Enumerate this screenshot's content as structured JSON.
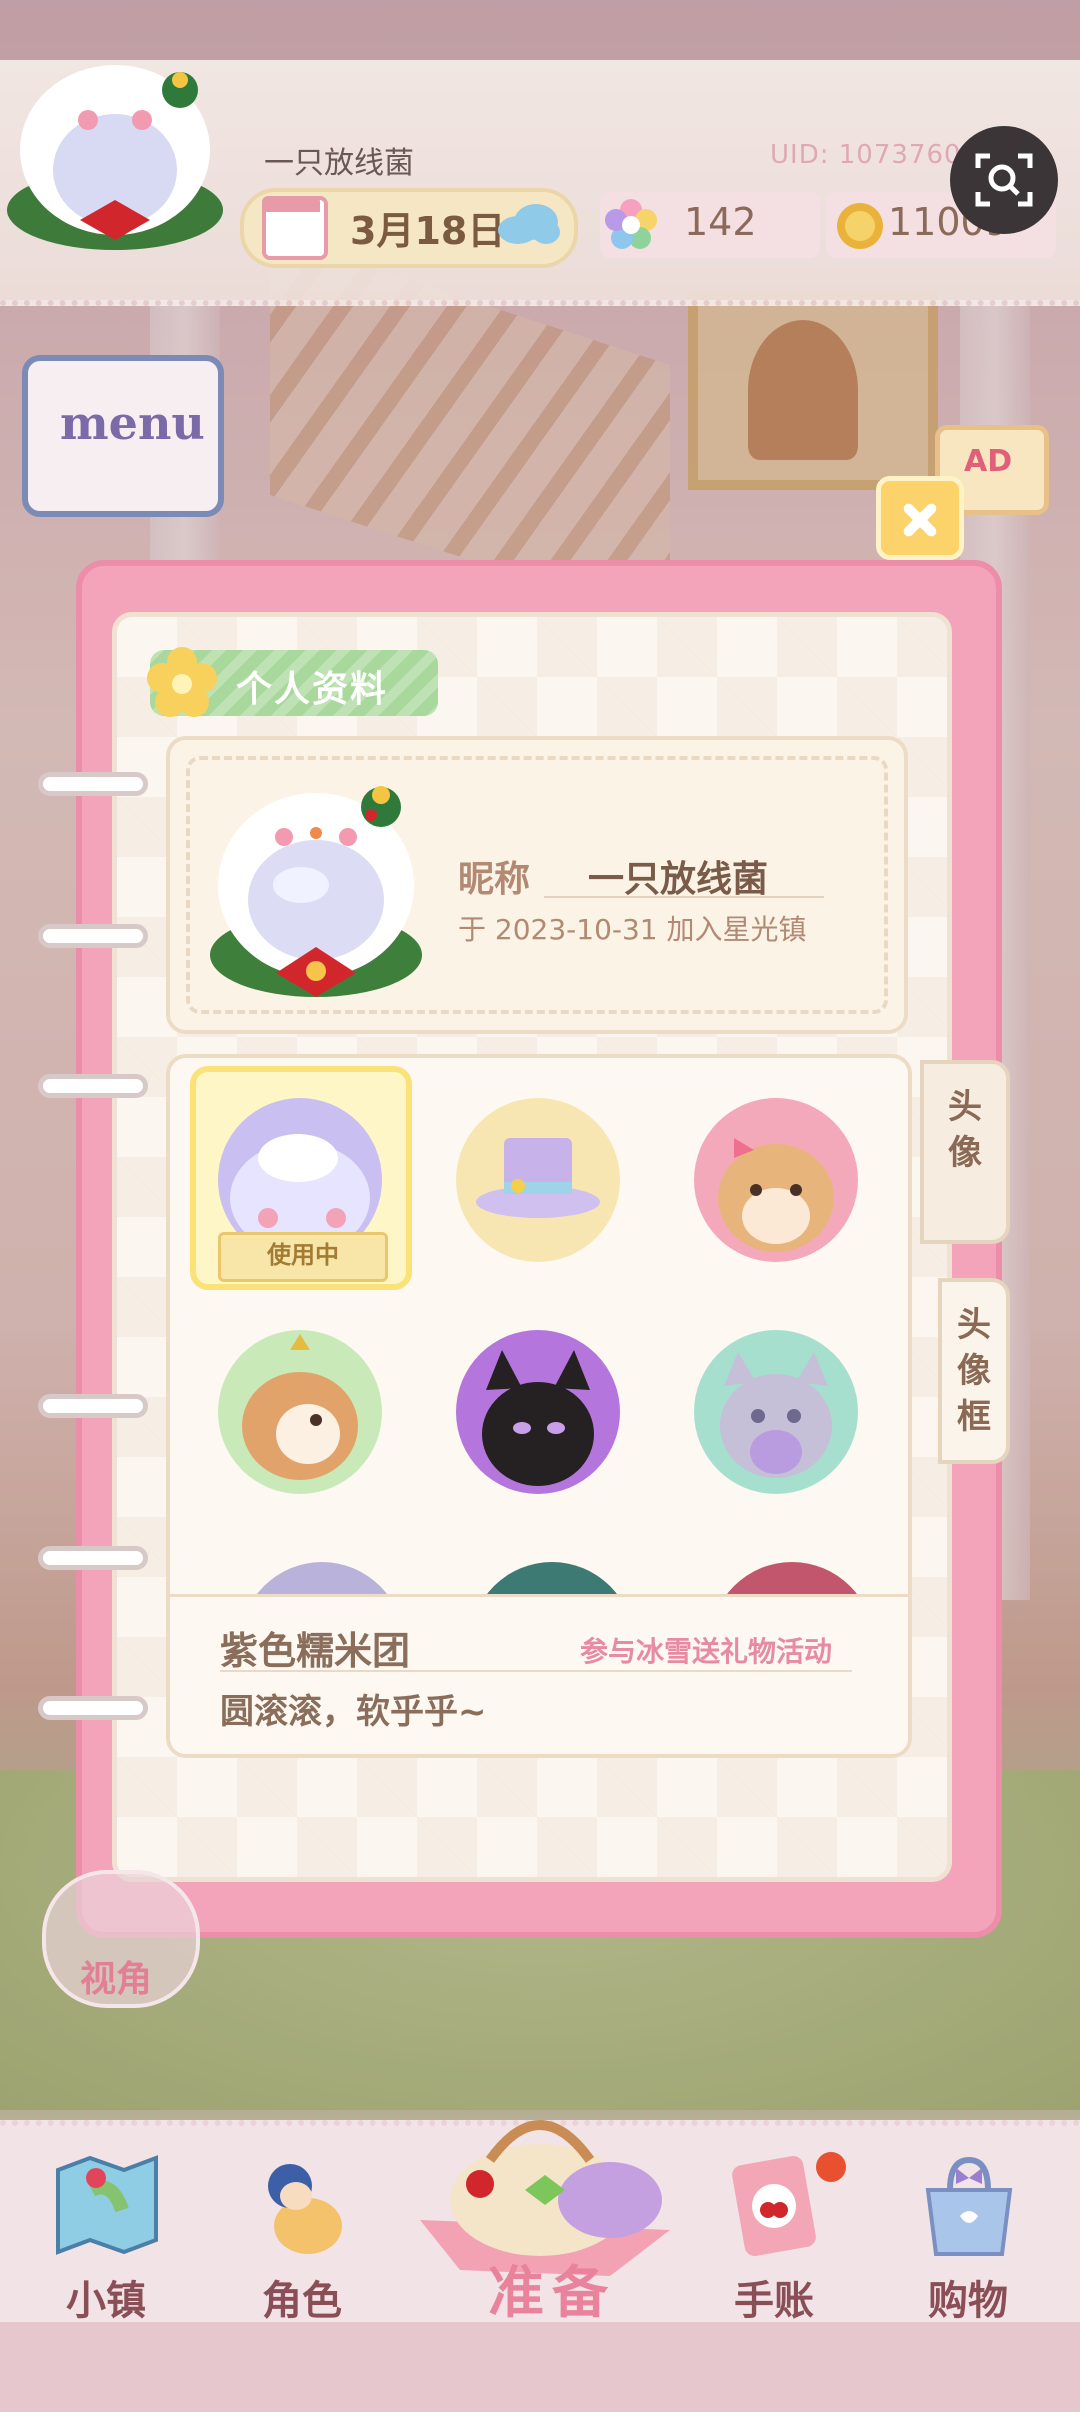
{
  "player": {
    "name": "一只放线菌",
    "uid": "UID: 10737601",
    "date": "3月18日",
    "flowers": "142",
    "coins": "11009"
  },
  "hud": {
    "menu_label": "menu",
    "ad_label": "AD"
  },
  "profile": {
    "section_title": "个人资料",
    "nickname_label": "昵称",
    "nickname": "一只放线菌",
    "join_text": "于 2023-10-31 加入星光镇"
  },
  "tabs": [
    {
      "label": "头\n像"
    },
    {
      "label": "头\n像\n框"
    }
  ],
  "avatars": {
    "in_use_label": "使用中",
    "items": [
      {
        "name": "purple-glutinous-ball",
        "selected": true
      },
      {
        "name": "purple-top-hat"
      },
      {
        "name": "shiba-with-bow"
      },
      {
        "name": "cream-puppy"
      },
      {
        "name": "black-cat"
      },
      {
        "name": "gray-cat"
      }
    ]
  },
  "selected_detail": {
    "title": "紫色糯米团",
    "source": "参与冰雪送礼物活动",
    "description": "圆滚滚，软乎乎~"
  },
  "view_button": "视角",
  "nav": {
    "items": [
      {
        "label": "小镇",
        "icon": "map-icon"
      },
      {
        "label": "角色",
        "icon": "character-icon"
      },
      {
        "label": "准备",
        "icon": "basket-icon"
      },
      {
        "label": "手账",
        "icon": "journal-icon"
      },
      {
        "label": "购物",
        "icon": "shopping-bag-icon"
      }
    ]
  },
  "colors": {
    "panel_pink": "#f3a4bb",
    "page_cream": "#fbf6ef",
    "title_green": "#a8d89b",
    "accent_pink": "#e68ba1"
  }
}
